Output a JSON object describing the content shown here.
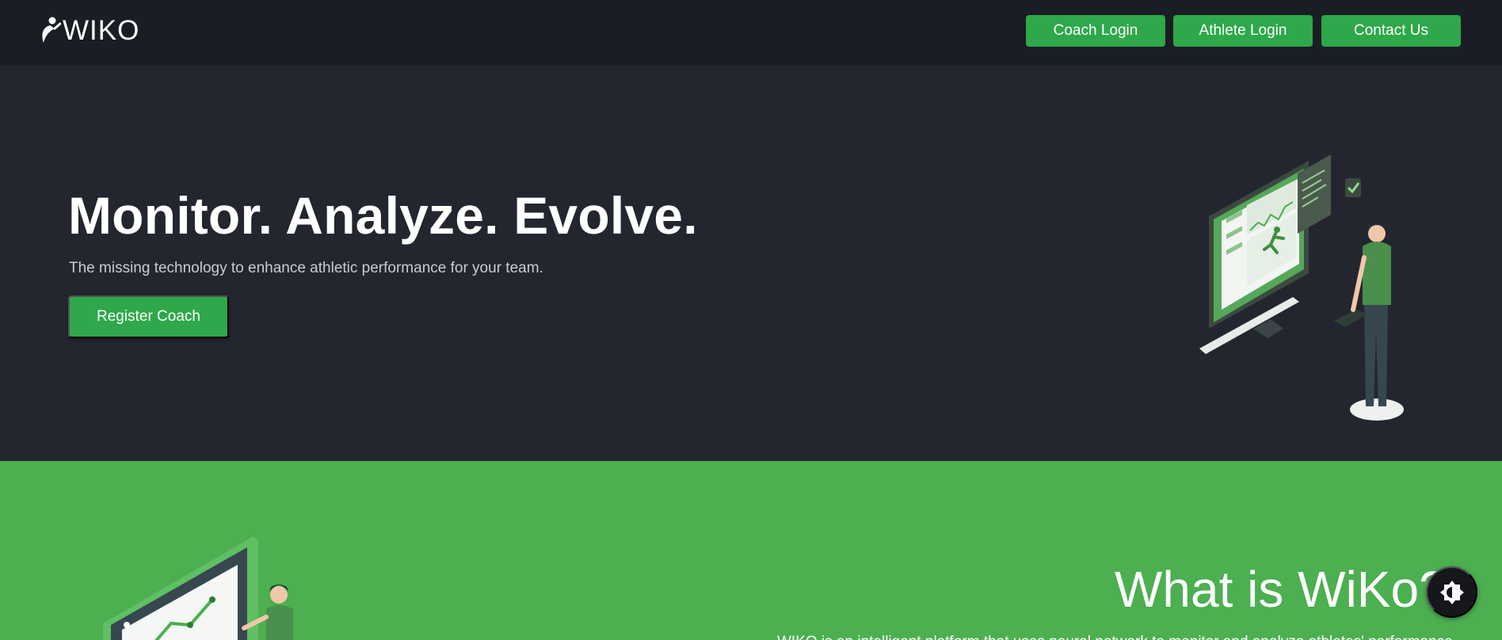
{
  "nav": {
    "logo_text": "WIKO",
    "coach_login": "Coach Login",
    "athlete_login": "Athlete Login",
    "contact_us": "Contact Us"
  },
  "hero": {
    "title": "Monitor. Analyze. Evolve.",
    "subtitle": "The missing technology to enhance athletic performance for your team.",
    "cta": "Register Coach",
    "illustration": "analytics-dashboard-illustration"
  },
  "about": {
    "title": "What is WiKo?",
    "text": "WIKO is an intelligent platform that uses neural network to monitor and analyze athletes' performance.",
    "illustration": "growth-chart-illustration"
  },
  "theme_toggle": {
    "icon": "brightness-icon"
  },
  "colors": {
    "nav_bg": "#1a1d24",
    "hero_bg": "#23262f",
    "accent": "#2ea84a",
    "about_bg": "#4caf50"
  }
}
